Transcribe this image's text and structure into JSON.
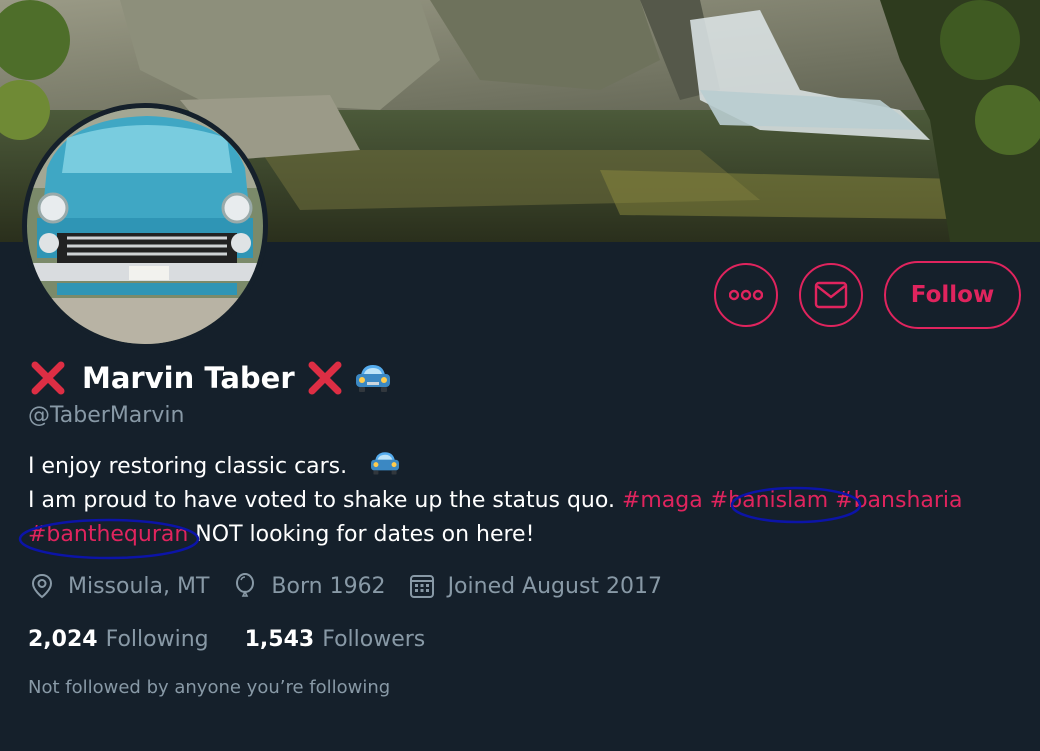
{
  "profile": {
    "display_name": "Marvin Taber",
    "handle": "@TaberMarvin",
    "bio_line1": "I enjoy restoring classic cars.",
    "bio_line2_text": "I am proud to have voted to shake up the status quo. ",
    "hashtags": [
      "#maga",
      "#banislam",
      "#bansharia",
      "#banthequran"
    ],
    "bio_tail": " NOT looking for dates on here!",
    "location": "Missoula, MT",
    "born": "Born 1962",
    "joined": "Joined August 2017",
    "following_count": "2,024",
    "following_label": "Following",
    "followers_count": "1,543",
    "followers_label": "Followers",
    "not_followed": "Not followed by anyone you’re following"
  },
  "actions": {
    "follow_label": "Follow"
  },
  "icons": {
    "more": "more-icon",
    "message": "envelope-icon",
    "location": "location-pin-icon",
    "birthday": "balloon-icon",
    "joined": "calendar-icon",
    "x_mark": "red-x-emoji",
    "car": "car-emoji"
  },
  "colors": {
    "background": "#15202b",
    "accent": "#e0245e",
    "muted": "#8899a6",
    "annotation": "#0c14a8"
  }
}
